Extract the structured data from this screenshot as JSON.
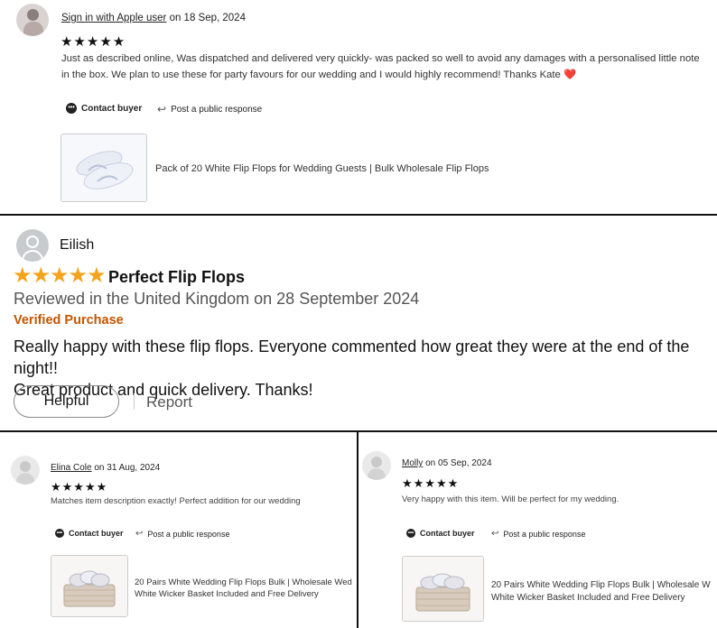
{
  "review1": {
    "author": "Sign in with Apple user",
    "date_text": "on 18 Sep, 2024",
    "stars": "★★★★★",
    "text": "Just as described online, Was dispatched and delivered very quickly- was packed so well to avoid any damages with a personalised little note in the box. We plan to use these for party favours for our wedding and I would highly recommend! Thanks Kate",
    "heart": "❤️",
    "contact_label": "Contact buyer",
    "post_response_label": "Post a public response",
    "product_title": "Pack of 20 White Flip Flops for Wedding Guests | Bulk Wholesale Flip Flops"
  },
  "review2": {
    "author": "Eilish",
    "stars": "★★★★★",
    "title": "Perfect Flip Flops",
    "reviewed_in": "Reviewed in the United Kingdom on 28 September 2024",
    "verified": "Verified Purchase",
    "text_line1": "Really happy with these flip flops. Everyone commented how great they were at the end of the night!!",
    "text_line2": "Great product and quick delivery. Thanks!",
    "helpful_label": "Helpful",
    "report_label": "Report",
    "star_color": "#f4a41c",
    "verified_color": "#c45500"
  },
  "review3": {
    "author": "Elina Cole",
    "date_text": "on 31 Aug, 2024",
    "stars": "★★★★★",
    "text": "Matches item description exactly! Perfect addition for our wedding",
    "contact_label": "Contact buyer",
    "post_response_label": "Post a public response",
    "product_line1": "20 Pairs White Wedding Flip Flops Bulk | Wholesale Wed",
    "product_line2": "White Wicker Basket Included and Free Delivery"
  },
  "review4": {
    "author": "Molly",
    "date_text": "on 05 Sep, 2024",
    "stars": "★★★★★",
    "text": "Very happy with this item. Will be perfect for my wedding.",
    "contact_label": "Contact buyer",
    "post_response_label": "Post a public response",
    "product_line1": "20 Pairs White Wedding Flip Flops Bulk | Wholesale W",
    "product_line2": "White Wicker Basket Included and Free Delivery"
  }
}
